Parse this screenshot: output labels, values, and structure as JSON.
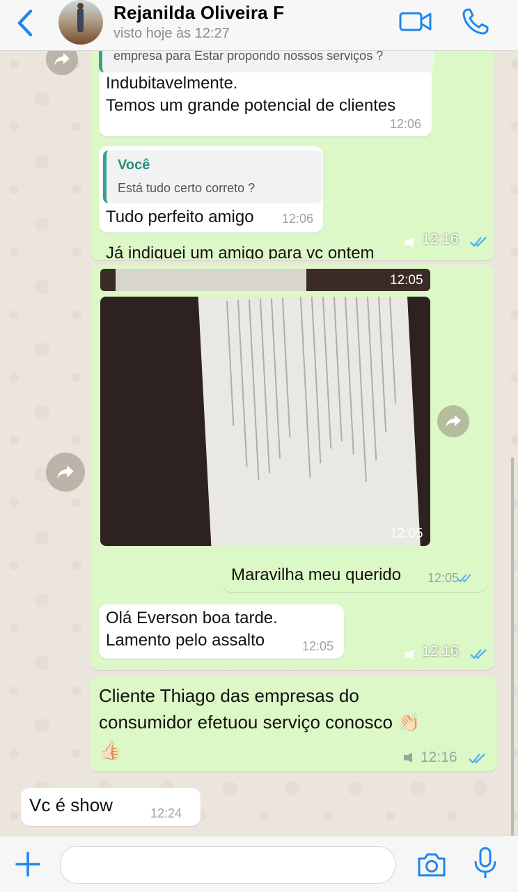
{
  "header": {
    "contact_name": "Rejanilda Oliveira F",
    "status": "visto hoje às 12:27",
    "icons": [
      "back-icon",
      "video-call-icon",
      "phone-call-icon"
    ]
  },
  "forwarded_1": {
    "quoted_top_text": "empresa para Estar propondo nossos serviços ?",
    "message1_lines": [
      "Indubitavelmente.",
      "Temos um grande potencial de clientes"
    ],
    "message1_time": "12:06",
    "quote_author": "Você",
    "quote_text": "Está tudo certo correto ?",
    "message2": "Tudo perfeito amigo",
    "message2_time": "12:06",
    "cut_message": "Já indiquei um amigo para vc ontem",
    "card_time": "12:16"
  },
  "forwarded_2": {
    "photo_strip_time": "12:05",
    "photo_time": "12:05",
    "out_message": "Maravilha meu querido",
    "out_time": "12:05",
    "in_message_lines": [
      "Olá Everson boa tarde.",
      "Lamento pelo assalto"
    ],
    "in_time": "12:05",
    "card_time": "12:16"
  },
  "outgoing": {
    "line1": "Cliente Thiago das empresas do",
    "line2": "consumidor efetuou serviço conosco 👏🏻",
    "line3": "👍🏻",
    "time": "12:16"
  },
  "incoming": {
    "text": "Vc é show",
    "time": "12:24"
  },
  "composer": {
    "placeholder": ""
  },
  "colors": {
    "accent_blue": "#1d86f0",
    "bubble_green": "#dcf8c6",
    "chat_bg": "#ece5dd",
    "read_ticks": "#4fb3f6"
  }
}
